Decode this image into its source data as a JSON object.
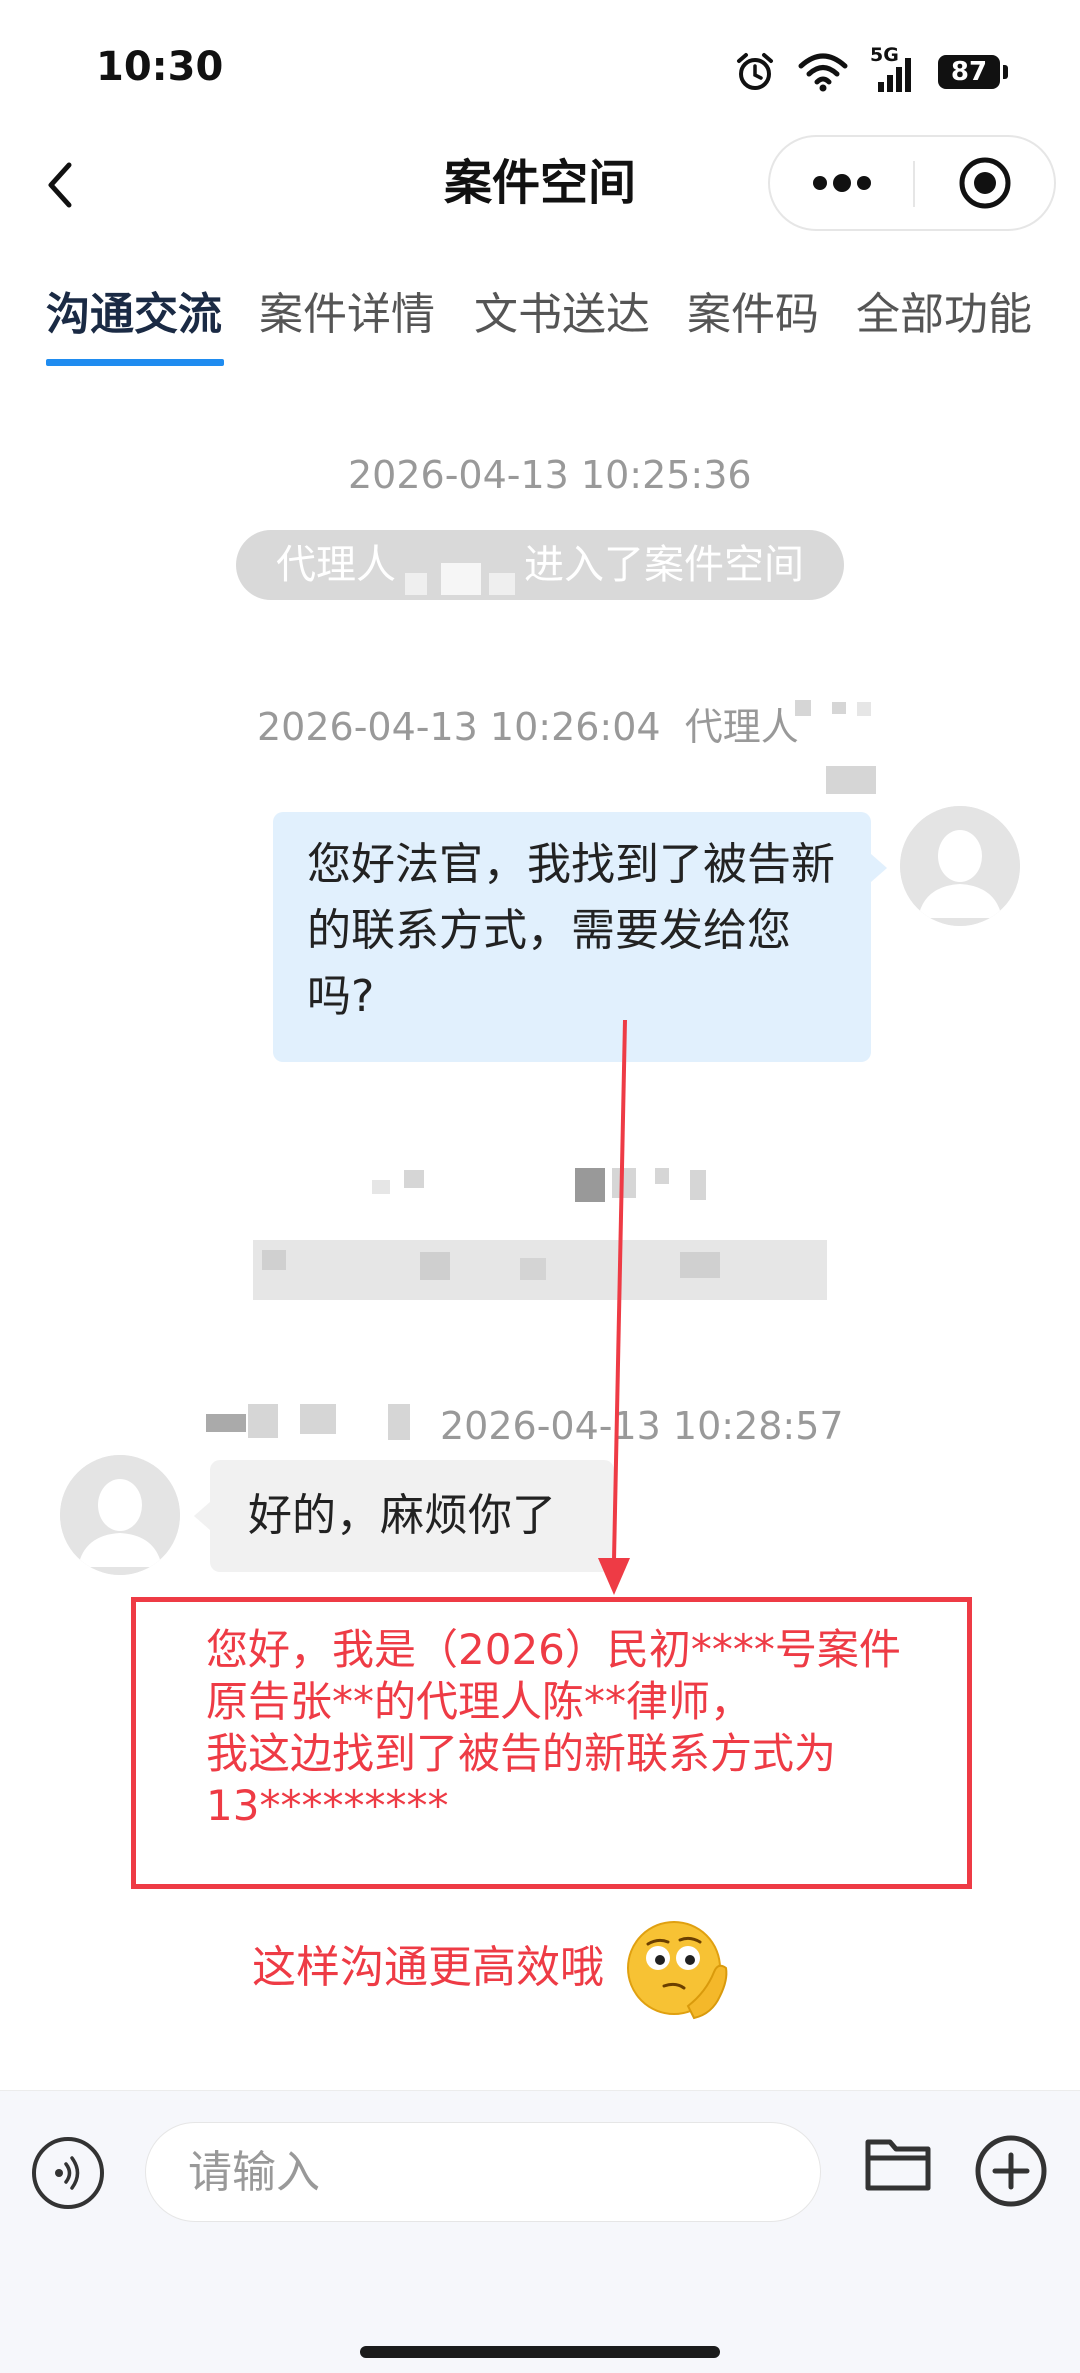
{
  "status_bar": {
    "time": "10:30",
    "network": "5G",
    "battery": "87",
    "icons": [
      "alarm-icon",
      "wifi-icon",
      "signal-icon",
      "battery-icon"
    ]
  },
  "nav": {
    "title": "案件空间",
    "icons": [
      "back-icon",
      "more-icon",
      "target-icon"
    ]
  },
  "tabs": [
    {
      "label": "沟通交流",
      "active": true
    },
    {
      "label": "案件详情",
      "active": false
    },
    {
      "label": "文书送达",
      "active": false
    },
    {
      "label": "案件码",
      "active": false
    },
    {
      "label": "全部功能",
      "active": false
    }
  ],
  "chat": {
    "system_time": "2026-04-13 10:25:36",
    "system_msg_prefix": "代理人",
    "system_msg_suffix": "进入了案件空间",
    "out_time": "2026-04-13 10:26:04",
    "out_sender_prefix": "代理人",
    "out_message": "您好法官，我找到了被告新的联系方式，需要发给您吗?",
    "in_time": "2026-04-13 10:28:57",
    "in_message": "好的，麻烦你了"
  },
  "annotation": {
    "color": "#ee3b45",
    "box_lines": [
      "您好，我是（2026）民初****号案件",
      "原告张**的代理人陈**律师，",
      "我这边找到了被告的新联系方式为",
      "13*********"
    ],
    "tip": "这样沟通更高效哦",
    "emoji": "thinking-face-emoji"
  },
  "input": {
    "placeholder": "请输入",
    "icons": [
      "voice-icon",
      "folder-icon",
      "add-icon"
    ]
  },
  "colors": {
    "accent": "#1f8cf0",
    "out_bubble": "#e1f0fd",
    "in_bubble": "#f1f1f1",
    "annotation": "#ee3b45"
  }
}
